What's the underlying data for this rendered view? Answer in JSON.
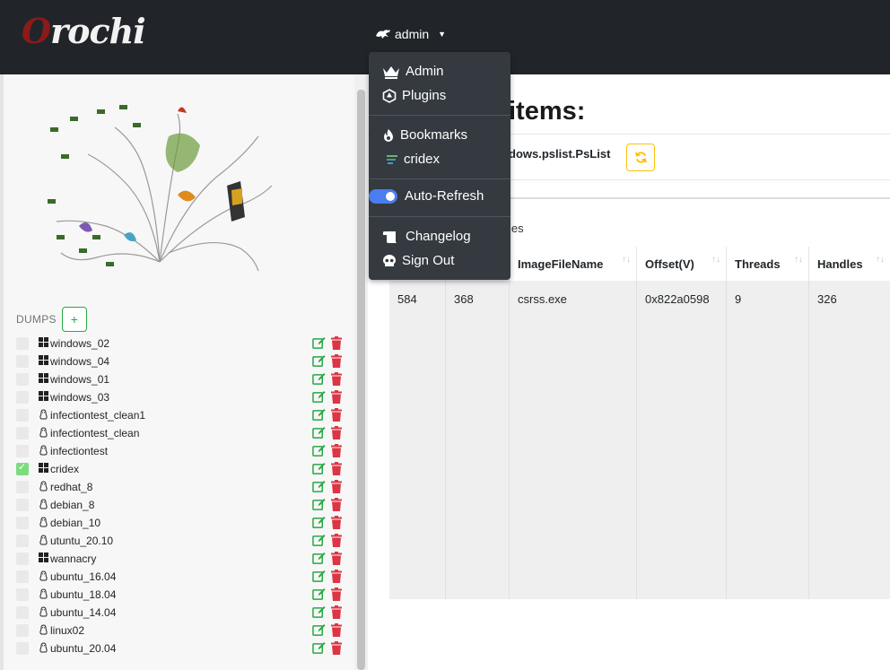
{
  "brand": {
    "name": "Orochi",
    "first": "O",
    "rest": "rochi"
  },
  "navbar": {
    "user_label": "admin"
  },
  "dropdown": {
    "items": [
      {
        "label": "Admin",
        "icon": "crown-icon"
      },
      {
        "label": "Plugins",
        "icon": "plugins-icon"
      },
      {
        "label": "Bookmarks",
        "icon": "fire-icon"
      },
      {
        "label": "cridex",
        "icon": "bookmark-image-icon"
      },
      {
        "label": "Auto-Refresh",
        "icon": "toggle-switch",
        "state": "on"
      },
      {
        "label": "Changelog",
        "icon": "scroll-icon"
      },
      {
        "label": "Sign Out",
        "icon": "skull-icon"
      }
    ]
  },
  "sidebar": {
    "dumps_label": "DUMPS",
    "add_label": "+",
    "dumps": [
      {
        "name": "windows_02",
        "os": "windows",
        "checked": false
      },
      {
        "name": "windows_04",
        "os": "windows",
        "checked": false
      },
      {
        "name": "windows_01",
        "os": "windows",
        "checked": false
      },
      {
        "name": "windows_03",
        "os": "windows",
        "checked": false
      },
      {
        "name": "infectiontest_clean1",
        "os": "linux",
        "checked": false
      },
      {
        "name": "infectiontest_clean",
        "os": "linux",
        "checked": false
      },
      {
        "name": "infectiontest",
        "os": "linux",
        "checked": false
      },
      {
        "name": "cridex",
        "os": "windows",
        "checked": true
      },
      {
        "name": "redhat_8",
        "os": "linux",
        "checked": false
      },
      {
        "name": "debian_8",
        "os": "linux",
        "checked": false
      },
      {
        "name": "debian_10",
        "os": "linux",
        "checked": false
      },
      {
        "name": "utuntu_20.10",
        "os": "linux",
        "checked": false
      },
      {
        "name": "wannacry",
        "os": "windows",
        "checked": false
      },
      {
        "name": "ubuntu_16.04",
        "os": "linux",
        "checked": false
      },
      {
        "name": "ubuntu_18.04",
        "os": "linux",
        "checked": false
      },
      {
        "name": "ubuntu_14.04",
        "os": "linux",
        "checked": false
      },
      {
        "name": "linux02",
        "os": "linux",
        "checked": false
      },
      {
        "name": "ubuntu_20.04",
        "os": "linux",
        "checked": false
      }
    ]
  },
  "main": {
    "title_visible": "items:",
    "plugin_visible": "dows.pslist.PsList",
    "entries_visible": "ies",
    "table": {
      "columns": [
        "ImageFileName",
        "Offset(V)",
        "Threads",
        "Handles"
      ],
      "rows": [
        [
          "584",
          "368",
          "csrss.exe",
          "0x822a0598",
          "9",
          "326"
        ]
      ]
    }
  },
  "colors": {
    "navbar": "#212529",
    "dropdown": "#343a40",
    "success": "#28a745",
    "danger": "#dc3545",
    "warning": "#ffc107",
    "toggle": "#4a7df0"
  }
}
